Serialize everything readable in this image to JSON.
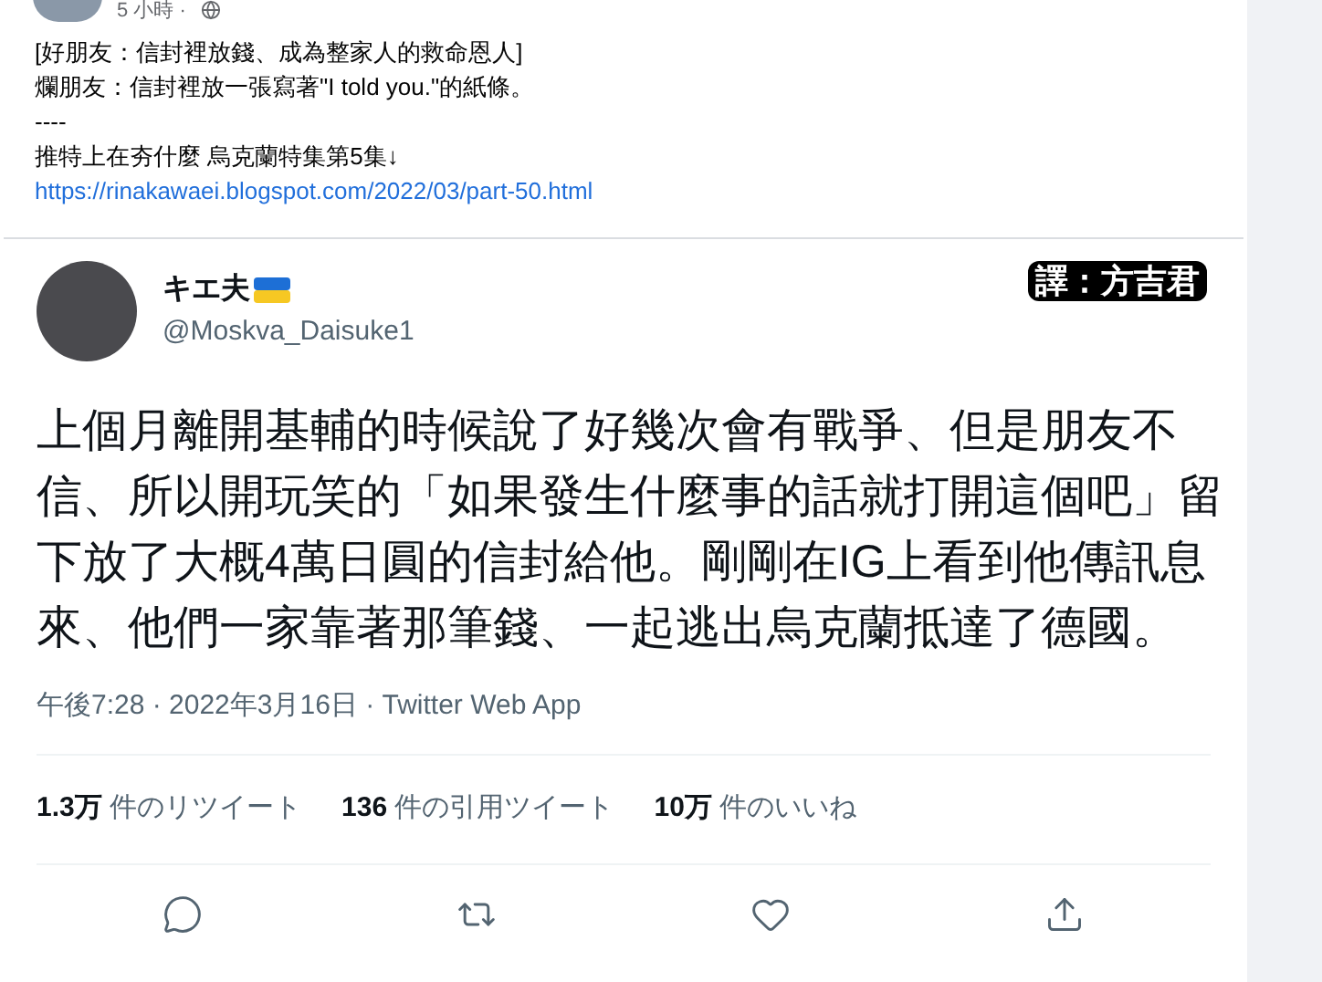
{
  "post": {
    "time": "5 小時 ·",
    "lines": [
      "[好朋友：信封裡放錢、成為整家人的救命恩人]",
      "爛朋友：信封裡放一張寫著\"I told you.\"的紙條。",
      "----",
      "推特上在夯什麼 烏克蘭特集第5集↓"
    ],
    "link": "https://rinakawaei.blogspot.com/2022/03/part-50.html"
  },
  "tweet": {
    "name": "キエ夫",
    "handle": "@Moskva_Daisuke1",
    "credit": "譯：方吉君",
    "text": "上個月離開基輔的時候說了好幾次會有戰爭、但是朋友不信、所以開玩笑的「如果發生什麼事的話就打開這個吧」留下放了大概4萬日圓的信封給他。剛剛在IG上看到他傳訊息來、他們一家靠著那筆錢、一起逃出烏克蘭抵達了德國。",
    "meta": "午後7:28 · 2022年3月16日 · Twitter Web App",
    "stats": [
      {
        "count": "1.3万",
        "label": "件のリツイート"
      },
      {
        "count": "136",
        "label": "件の引用ツイート"
      },
      {
        "count": "10万",
        "label": "件のいいね"
      }
    ],
    "actions": [
      {
        "kind": "reply"
      },
      {
        "kind": "retweet"
      },
      {
        "kind": "like"
      },
      {
        "kind": "share"
      }
    ]
  }
}
